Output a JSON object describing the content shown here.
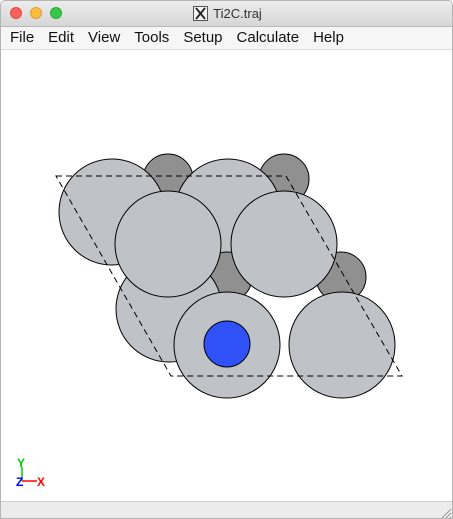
{
  "window": {
    "title": "Ti2C.traj",
    "icon": "x11-icon"
  },
  "menu": [
    {
      "label": "File"
    },
    {
      "label": "Edit"
    },
    {
      "label": "View"
    },
    {
      "label": "Tools"
    },
    {
      "label": "Setup"
    },
    {
      "label": "Calculate"
    },
    {
      "label": "Help"
    }
  ],
  "viewer": {
    "atom_colors": {
      "Ti": "#bfc2c7",
      "C": "#909090",
      "selected": "#3050f8"
    },
    "cell_line_style": "dashed",
    "axes": {
      "y_label": "Y",
      "x_label": "X",
      "z_label": "Z",
      "y_color": "#00cc00",
      "x_color": "#ff0000",
      "z_color": "#0000ff"
    }
  }
}
